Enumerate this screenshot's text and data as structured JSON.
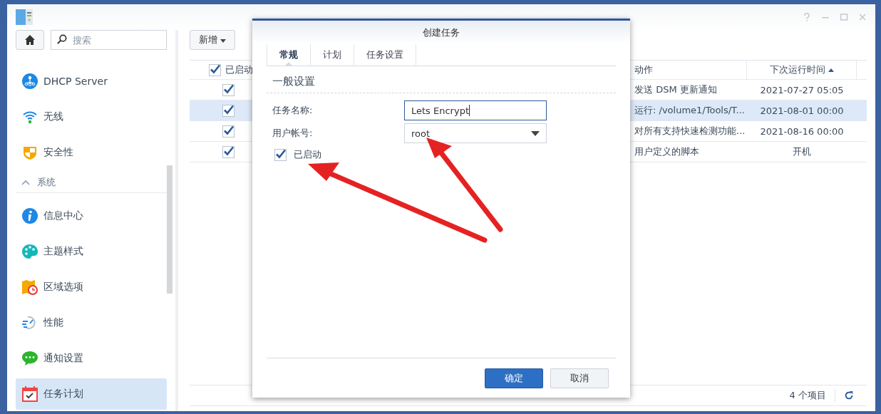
{
  "sidebar": {
    "search": {
      "placeholder": "搜索"
    },
    "items": [
      {
        "kind": "item",
        "label": "DHCP Server",
        "selected": false
      },
      {
        "kind": "item",
        "label": "无线",
        "selected": false
      },
      {
        "kind": "item",
        "label": "安全性",
        "selected": false
      },
      {
        "kind": "section",
        "label": "系统",
        "expanded": true
      },
      {
        "kind": "item",
        "label": "信息中心",
        "selected": false
      },
      {
        "kind": "item",
        "label": "主题样式",
        "selected": false
      },
      {
        "kind": "item",
        "label": "区域选项",
        "selected": false
      },
      {
        "kind": "item",
        "label": "性能",
        "selected": false
      },
      {
        "kind": "item",
        "label": "通知设置",
        "selected": false
      },
      {
        "kind": "item",
        "label": "任务计划",
        "selected": true
      }
    ]
  },
  "toolbar": {
    "create_button": "新增"
  },
  "table": {
    "columns": [
      {
        "label": "已启动",
        "checked": true,
        "sorted": false
      },
      {
        "label": "动作",
        "sorted": false
      },
      {
        "label": "下次运行时间",
        "sorted": true
      }
    ],
    "rows": [
      {
        "enabled": true,
        "action": "发送 DSM 更新通知",
        "next_run": "2021-07-27 05:05",
        "selected": false
      },
      {
        "enabled": true,
        "action": "运行: /volume1/Tools/T...",
        "next_run": "2021-08-01 00:00",
        "selected": true
      },
      {
        "enabled": true,
        "action": "对所有支持快速检测功能...",
        "next_run": "2021-08-16 00:00",
        "selected": false
      },
      {
        "enabled": true,
        "action": "用户定义的脚本",
        "next_run": "开机",
        "selected": false
      }
    ]
  },
  "status_bar": {
    "count": "4 个项目"
  },
  "dialog": {
    "title": "创建任务",
    "tabs": [
      {
        "label": "常规",
        "selected": true
      },
      {
        "label": "计划",
        "selected": false
      },
      {
        "label": "任务设置",
        "selected": false
      }
    ],
    "section": "一般设置",
    "fields": [
      {
        "kind": "text",
        "label": "任务名称:",
        "value": "Lets Encrypt",
        "focused": true
      },
      {
        "kind": "dropdown",
        "label": "用户帐号:",
        "value": "root",
        "focused": false
      }
    ],
    "enabled": {
      "label": "已启动",
      "checked": true
    },
    "buttons": [
      {
        "kind": "primary",
        "label": "确定"
      },
      {
        "kind": "secondary",
        "label": "取消"
      }
    ]
  }
}
